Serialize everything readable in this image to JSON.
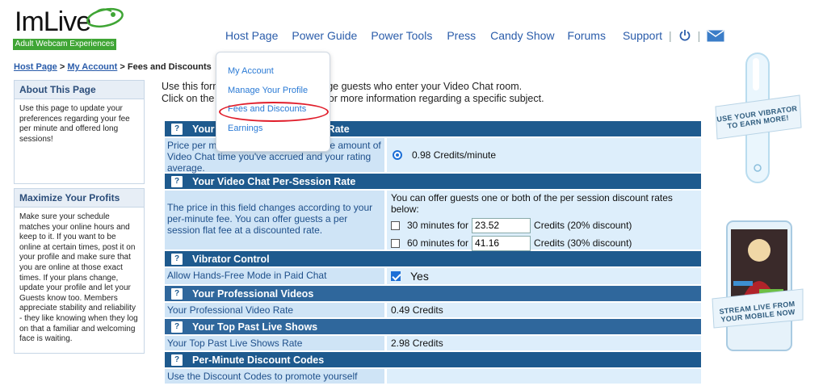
{
  "logo": {
    "brand": "ImLive",
    "tagline": "Adult Webcam Experiences"
  },
  "topnav": {
    "items": [
      "Host Page",
      "Power Guide",
      "Power Tools",
      "Press",
      "Candy Show",
      "Forums",
      "Support"
    ],
    "separator": "|",
    "icons": [
      "power-icon",
      "mail-icon"
    ]
  },
  "breadcrumb": {
    "home": "Host Page",
    "account": "My Account",
    "sep": ">",
    "current": "Fees and Discounts"
  },
  "dropdown": {
    "items": [
      "My Account",
      "Manage Your Profile",
      "Fees and Discounts",
      "Earnings"
    ],
    "highlighted": "Fees and Discounts"
  },
  "sidebar": {
    "about": {
      "title": "About This Page",
      "body": "Use this page to update your preferences regarding your fee per minute and offered long sessions!"
    },
    "profits": {
      "title": "Maximize Your Profits",
      "body": "Make sure your schedule matches your online hours and keep to it. If you want to be online at certain times, post it on your profile and make sure that you are online at those exact times. If your plans change, update your profile and let your Guests know too. Members appreciate stability and reliability - they like knowing when they log on that a familiar and welcoming face is waiting."
    }
  },
  "intro": {
    "line1_a": "Use this form",
    "line1_b": "u will charge guests who enter your Video Chat room.",
    "line2_a": "Click on the",
    "line2_b": "for more information regarding a specific subject."
  },
  "sections": {
    "rate": {
      "icon": "?",
      "title_a": "Your",
      "title_b": "Rate",
      "left_a": "Price per m",
      "left_b": "the amount",
      "left_c": "of Video Chat time you've accrued and your rating average.",
      "value": "0.98 Credits/minute"
    },
    "session": {
      "icon": "?",
      "title": "Your Video Chat Per-Session Rate",
      "left": "The price in this field changes according to your per-minute fee. You can offer guests a per session flat fee at a discounted rate.",
      "right_intro": "You can offer guests one or both of the per session discount rates below:",
      "options": [
        {
          "label": "30 minutes for",
          "value": "23.52",
          "suffix": "Credits (20% discount)",
          "checked": false
        },
        {
          "label": "60 minutes for",
          "value": "41.16",
          "suffix": "Credits (30% discount)",
          "checked": false
        }
      ]
    },
    "vibrator": {
      "icon": "?",
      "title": "Vibrator Control",
      "left": "Allow Hands-Free Mode in Paid Chat",
      "value": "Yes",
      "checked": true
    },
    "videos": {
      "icon": "?",
      "title": "Your Professional Videos",
      "left": "Your Professional Video Rate",
      "value": "0.49 Credits"
    },
    "shows": {
      "icon": "?",
      "title": "Your Top Past Live Shows",
      "left": "Your Top Past Live Shows Rate",
      "value": "2.98 Credits"
    },
    "codes": {
      "icon": "?",
      "title": "Per-Minute Discount Codes",
      "left": "Use the Discount Codes to promote yourself"
    }
  },
  "ads": {
    "vibrator": "USE YOUR VIBRATOR TO EARN MORE!",
    "mobile": "STREAM LIVE FROM YOUR MOBILE NOW"
  },
  "colors": {
    "header": "#1e5a8e",
    "cellLeft": "#cfe4f6",
    "cellRight": "#ddeefb",
    "link": "#2a5caa",
    "highlight": "#e01d2a",
    "logoGreen": "#3fa535"
  }
}
